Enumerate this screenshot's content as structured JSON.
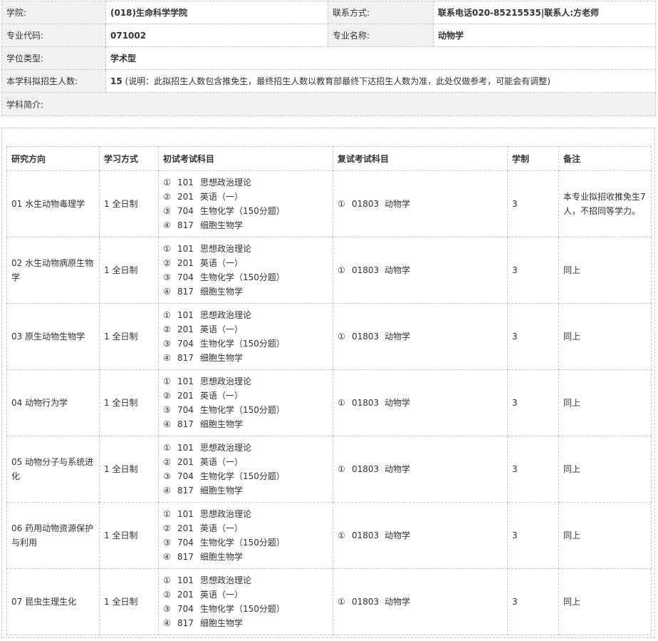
{
  "info": {
    "college_label": "学院:",
    "college_value": "(018)生命科学学院",
    "contact_label": "联系方式:",
    "contact_value": "联系电话020-85215535|联系人:方老师",
    "major_code_label": "专业代码:",
    "major_code_value": "071002",
    "major_name_label": "专业名称:",
    "major_name_value": "动物学",
    "degree_type_label": "学位类型:",
    "degree_type_value": "学术型",
    "enroll_label": "本学科拟招生人数:",
    "enroll_count": "15",
    "enroll_note": "(说明：此拟招生人数包含推免生，最终招生人数以教育部最终下达招生人数为准，此处仅做参考，可能会有调整)",
    "intro_label": "学科简介:"
  },
  "table": {
    "headers": [
      "研究方向",
      "学习方式",
      "初试考试科目",
      "复试考试科目",
      "学制",
      "备注"
    ],
    "rows": [
      {
        "direction": "01 水生动物毒理学",
        "mode": "1 全日制",
        "exam": [
          {
            "no": "①",
            "code": "101",
            "name": "思想政治理论"
          },
          {
            "no": "②",
            "code": "201",
            "name": "英语（一）"
          },
          {
            "no": "③",
            "code": "704",
            "name": "生物化学（150分题）"
          },
          {
            "no": "④",
            "code": "817",
            "name": "细胞生物学"
          }
        ],
        "retest": {
          "no": "①",
          "code": "01803",
          "name": "动物学"
        },
        "years": "3",
        "note": "本专业拟招收推免生7人，不招同等学力。"
      },
      {
        "direction": "02 水生动物病原生物学",
        "mode": "1 全日制",
        "exam": [
          {
            "no": "①",
            "code": "101",
            "name": "思想政治理论"
          },
          {
            "no": "②",
            "code": "201",
            "name": "英语（一）"
          },
          {
            "no": "③",
            "code": "704",
            "name": "生物化学（150分题）"
          },
          {
            "no": "④",
            "code": "817",
            "name": "细胞生物学"
          }
        ],
        "retest": {
          "no": "①",
          "code": "01803",
          "name": "动物学"
        },
        "years": "3",
        "note": "同上"
      },
      {
        "direction": "03 原生动物生物学",
        "mode": "1 全日制",
        "exam": [
          {
            "no": "①",
            "code": "101",
            "name": "思想政治理论"
          },
          {
            "no": "②",
            "code": "201",
            "name": "英语（一）"
          },
          {
            "no": "③",
            "code": "704",
            "name": "生物化学（150分题）"
          },
          {
            "no": "④",
            "code": "817",
            "name": "细胞生物学"
          }
        ],
        "retest": {
          "no": "①",
          "code": "01803",
          "name": "动物学"
        },
        "years": "3",
        "note": "同上"
      },
      {
        "direction": "04 动物行为学",
        "mode": "1 全日制",
        "exam": [
          {
            "no": "①",
            "code": "101",
            "name": "思想政治理论"
          },
          {
            "no": "②",
            "code": "201",
            "name": "英语（一）"
          },
          {
            "no": "③",
            "code": "704",
            "name": "生物化学（150分题）"
          },
          {
            "no": "④",
            "code": "817",
            "name": "细胞生物学"
          }
        ],
        "retest": {
          "no": "①",
          "code": "01803",
          "name": "动物学"
        },
        "years": "3",
        "note": "同上"
      },
      {
        "direction": "05 动物分子与系统进化",
        "mode": "1 全日制",
        "exam": [
          {
            "no": "①",
            "code": "101",
            "name": "思想政治理论"
          },
          {
            "no": "②",
            "code": "201",
            "name": "英语（一）"
          },
          {
            "no": "③",
            "code": "704",
            "name": "生物化学（150分题）"
          },
          {
            "no": "④",
            "code": "817",
            "name": "细胞生物学"
          }
        ],
        "retest": {
          "no": "①",
          "code": "01803",
          "name": "动物学"
        },
        "years": "3",
        "note": "同上"
      },
      {
        "direction": "06 药用动物资源保护与利用",
        "mode": "1 全日制",
        "exam": [
          {
            "no": "①",
            "code": "101",
            "name": "思想政治理论"
          },
          {
            "no": "②",
            "code": "201",
            "name": "英语（一）"
          },
          {
            "no": "③",
            "code": "704",
            "name": "生物化学（150分题）"
          },
          {
            "no": "④",
            "code": "817",
            "name": "细胞生物学"
          }
        ],
        "retest": {
          "no": "①",
          "code": "01803",
          "name": "动物学"
        },
        "years": "3",
        "note": "同上"
      },
      {
        "direction": "07 昆虫生理生化",
        "mode": "1 全日制",
        "exam": [
          {
            "no": "①",
            "code": "101",
            "name": "思想政治理论"
          },
          {
            "no": "②",
            "code": "201",
            "name": "英语（一）"
          },
          {
            "no": "③",
            "code": "704",
            "name": "生物化学（150分题）"
          },
          {
            "no": "④",
            "code": "817",
            "name": "细胞生物学"
          }
        ],
        "retest": {
          "no": "①",
          "code": "01803",
          "name": "动物学"
        },
        "years": "3",
        "note": "同上"
      }
    ]
  }
}
